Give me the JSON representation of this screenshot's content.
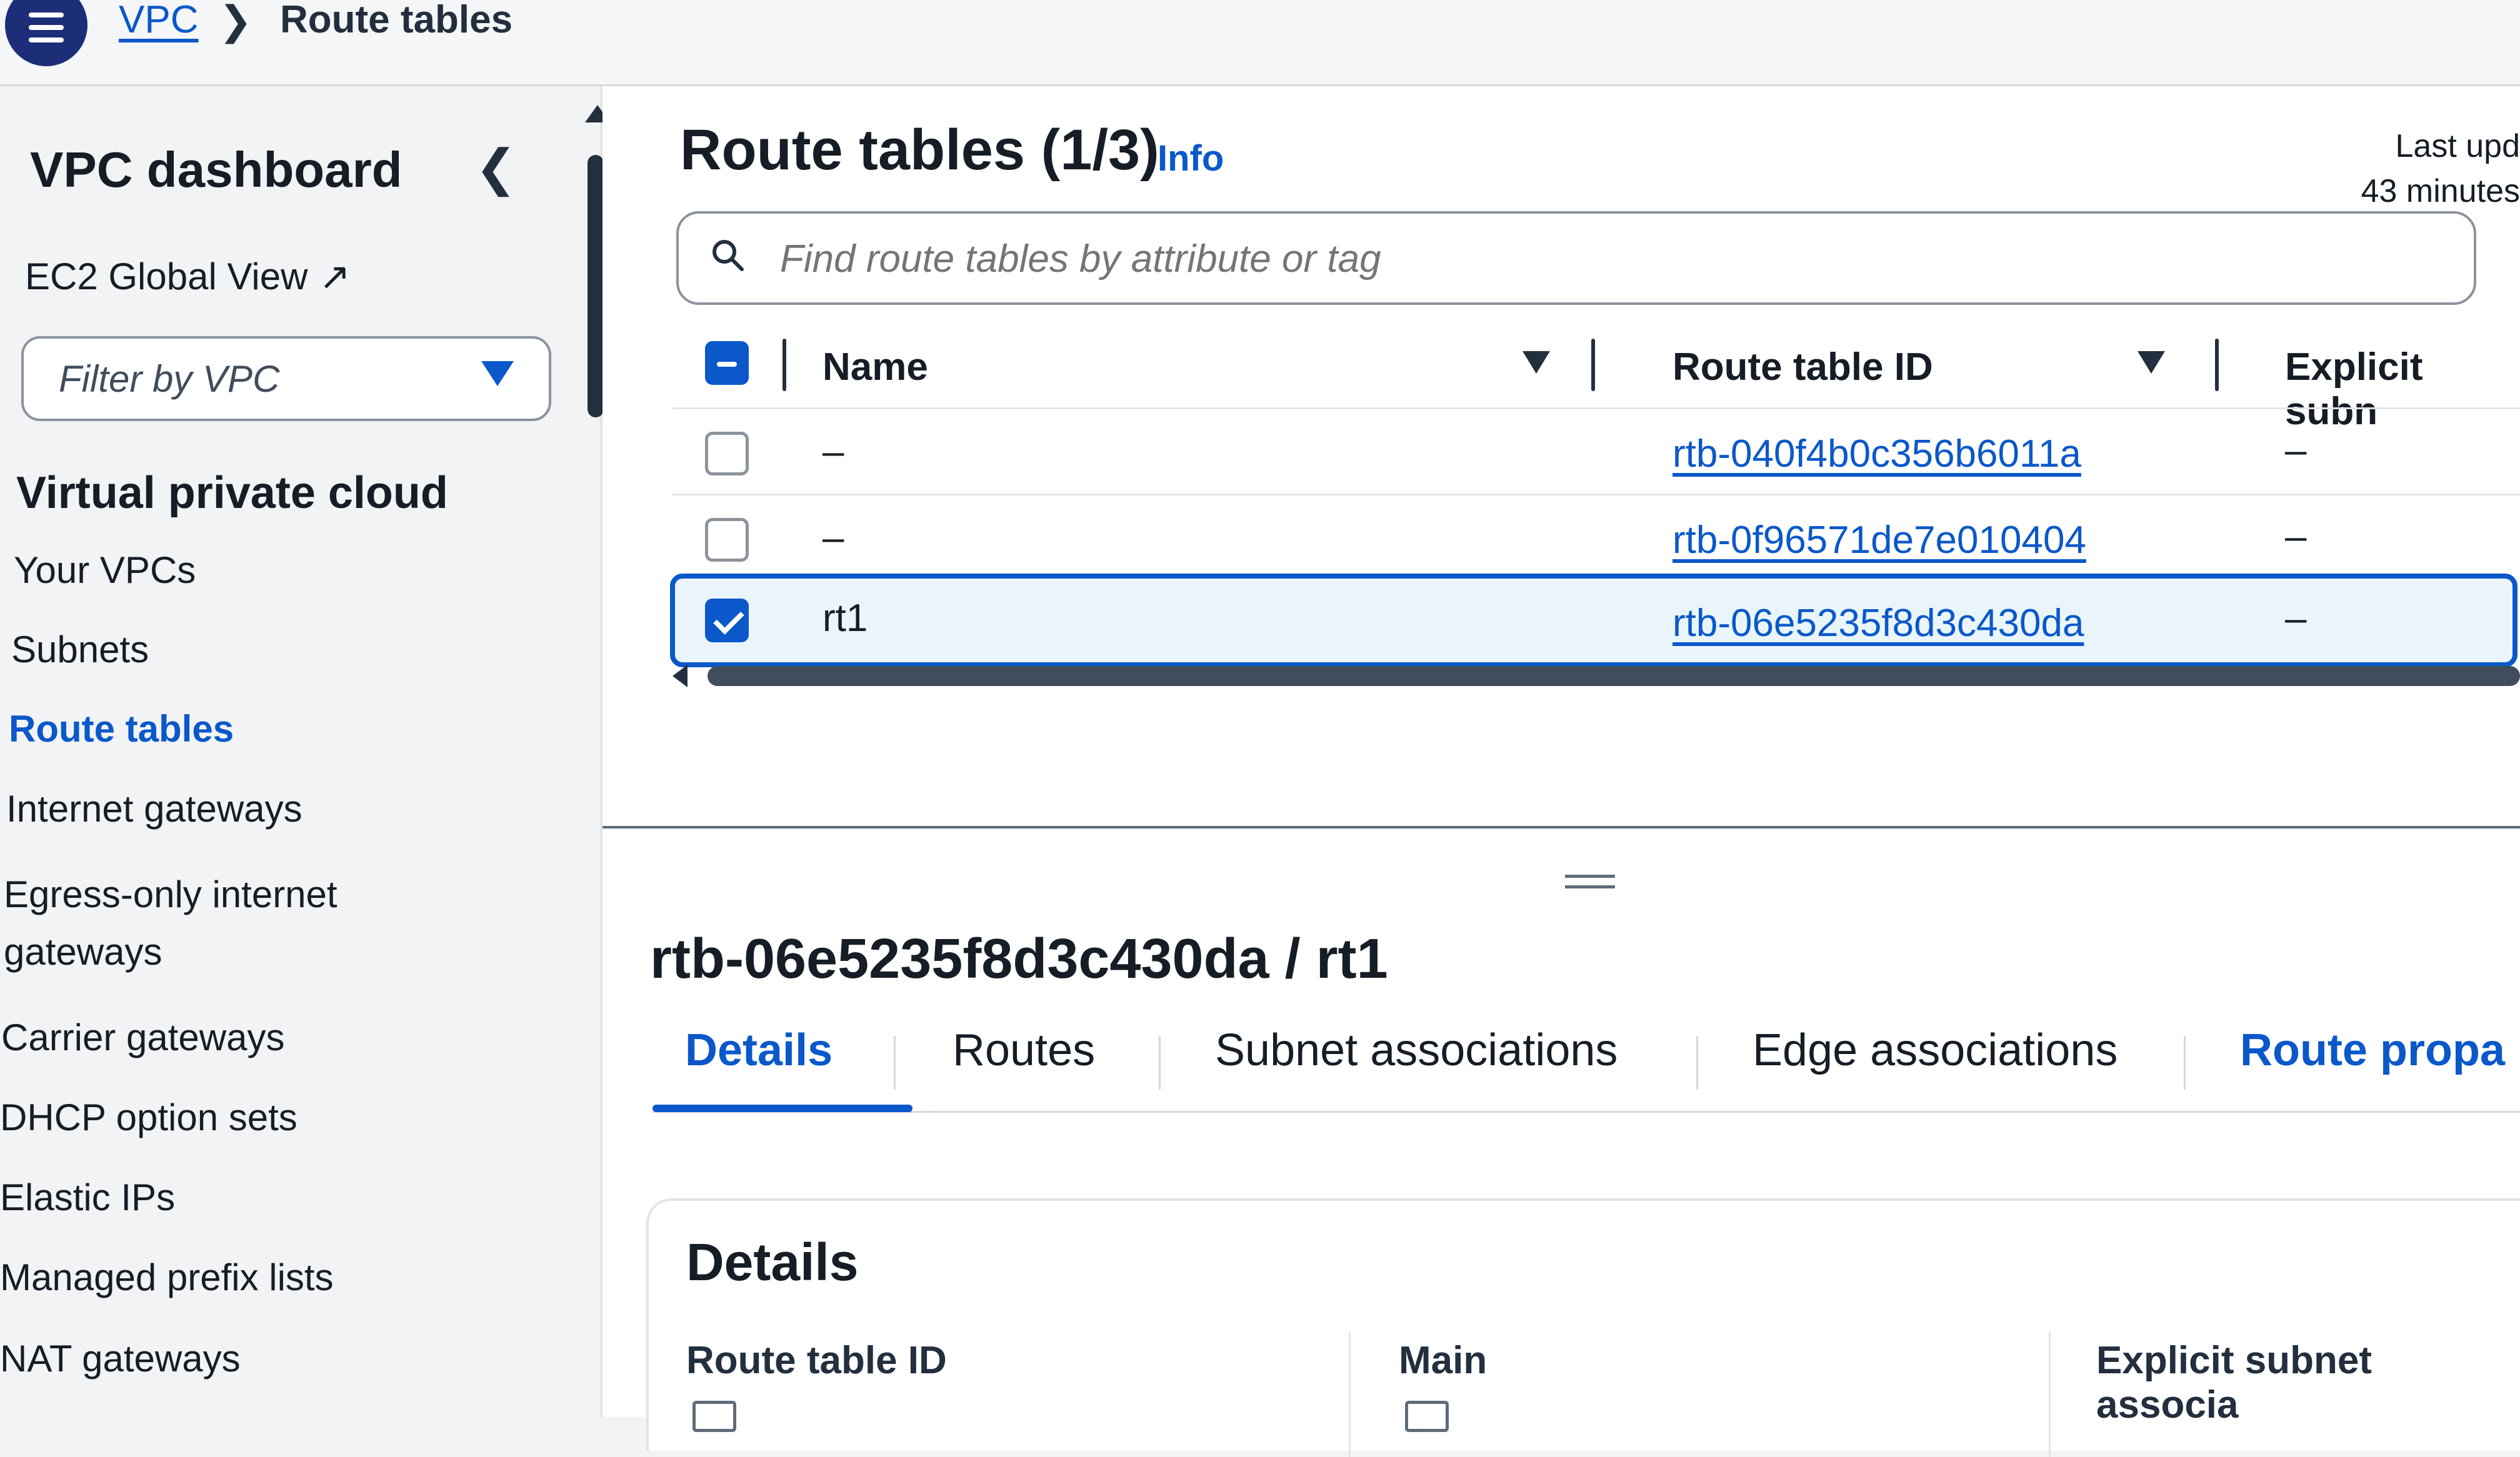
{
  "topbar": {
    "breadcrumb_root": "VPC",
    "breadcrumb_current": "Route tables"
  },
  "sidebar": {
    "title": "VPC dashboard",
    "ec2_global_view": "EC2 Global View",
    "filter_placeholder": "Filter by VPC",
    "section_title": "Virtual private cloud",
    "items": [
      {
        "label": "Your VPCs"
      },
      {
        "label": "Subnets"
      },
      {
        "label": "Route tables",
        "active": true
      },
      {
        "label": "Internet gateways"
      },
      {
        "label": "Egress-only internet gateways"
      },
      {
        "label": "Carrier gateways"
      },
      {
        "label": "DHCP option sets"
      },
      {
        "label": "Elastic IPs"
      },
      {
        "label": "Managed prefix lists"
      },
      {
        "label": "NAT gateways"
      }
    ]
  },
  "main": {
    "title": "Route tables (1/3)",
    "info_label": "Info",
    "last_updated_line1": "Last upd",
    "last_updated_line2": "43 minutes",
    "search_placeholder": "Find route tables by attribute or tag",
    "columns": {
      "name": "Name",
      "route_table_id": "Route table ID",
      "explicit_subnet": "Explicit subn"
    },
    "rows": [
      {
        "name": "–",
        "id": "rtb-040f4b0c356b6011a",
        "explicit": "–",
        "selected": false
      },
      {
        "name": "–",
        "id": "rtb-0f96571de7e010404",
        "explicit": "–",
        "selected": false
      },
      {
        "name": "rt1",
        "id": "rtb-06e5235f8d3c430da",
        "explicit": "–",
        "selected": true
      }
    ]
  },
  "details": {
    "title": "rtb-06e5235f8d3c430da / rt1",
    "tabs": [
      "Details",
      "Routes",
      "Subnet associations",
      "Edge associations",
      "Route propa"
    ],
    "active_tab": "Details",
    "heading": "Details",
    "fields": {
      "route_table_id": "Route table ID",
      "main": "Main",
      "explicit_subnet_assoc": "Explicit subnet associa"
    }
  },
  "colors": {
    "accent": "#0a58ca",
    "text": "#161d26",
    "selected_row_bg": "#eaf5fb",
    "menu_button": "#1d2e78"
  }
}
